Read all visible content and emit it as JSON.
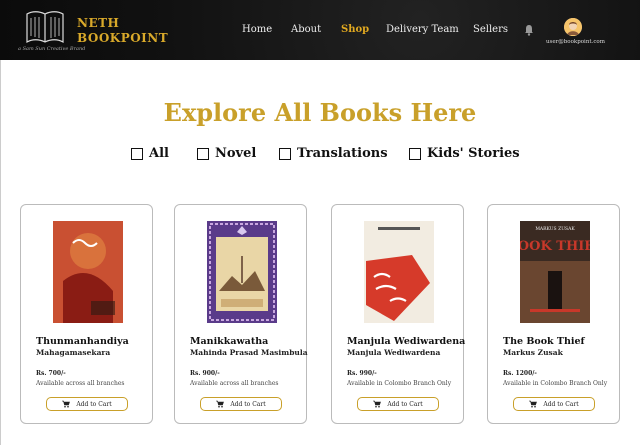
{
  "header": {
    "brand_line1": "NETH",
    "brand_line2": "BOOKPOINT",
    "tagline": "a Sam Sun Creative Brand",
    "nav": [
      {
        "label": "Home"
      },
      {
        "label": "About"
      },
      {
        "label": "Shop",
        "active": true
      },
      {
        "label": "Delivery Team"
      },
      {
        "label": "Sellers"
      }
    ],
    "user_email": "user@bookpoint.com",
    "accent_color": "#d9a92a"
  },
  "main": {
    "title": "Explore All Books Here",
    "filters": [
      {
        "label": "All"
      },
      {
        "label": "Novel"
      },
      {
        "label": "Translations"
      },
      {
        "label": "Kids' Stories"
      }
    ]
  },
  "books": [
    {
      "title": "Thunmanhandiya",
      "author": "Mahagamasekara",
      "price": "Rs. 700/-",
      "availability": "Available across all branches",
      "button": "Add to Cart"
    },
    {
      "title": "Manikkawatha",
      "author": "Mahinda Prasad Masimbula",
      "price": "Rs. 900/-",
      "availability": "Available across all branches",
      "button": "Add to Cart"
    },
    {
      "title": "Manjula Wediwardena",
      "author": "Manjula Wediwardena",
      "price": "Rs. 990/-",
      "availability": "Available in Colombo Branch Only",
      "button": "Add to Cart"
    },
    {
      "title": "The Book Thief",
      "author": "Markus Zusak",
      "price": "Rs. 1200/-",
      "availability": "Available in Colombo Branch Only",
      "button": "Add to Cart",
      "cover_title": "BOOK THIEF",
      "cover_author": "MARKUS ZUSAK"
    }
  ]
}
